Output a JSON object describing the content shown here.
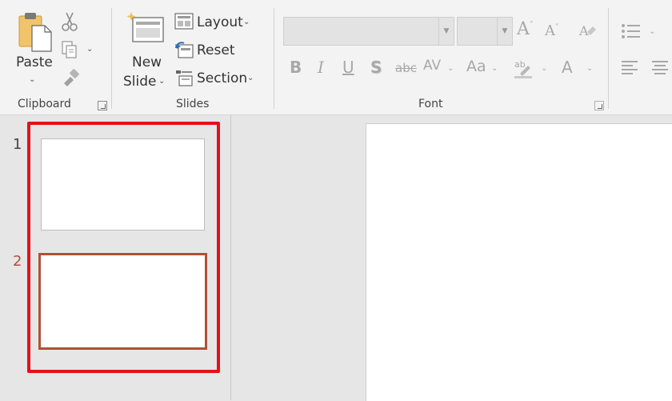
{
  "ribbon": {
    "clipboard": {
      "paste_label": "Paste",
      "group_label": "Clipboard"
    },
    "slides": {
      "new_slide_line1": "New",
      "new_slide_line2": "Slide",
      "layout_label": "Layout",
      "reset_label": "Reset",
      "section_label": "Section",
      "group_label": "Slides"
    },
    "font": {
      "font_name_value": "",
      "font_size_value": "",
      "group_label": "Font"
    }
  },
  "thumbnails": [
    {
      "number": "1",
      "selected": false
    },
    {
      "number": "2",
      "selected": true
    }
  ],
  "colors": {
    "highlight_box": "#e3101b",
    "selected_thumb_border": "#b24f37",
    "selected_number": "#b24f37",
    "ribbon_bg": "#f3f3f3",
    "workspace_bg": "#e6e6e6"
  }
}
